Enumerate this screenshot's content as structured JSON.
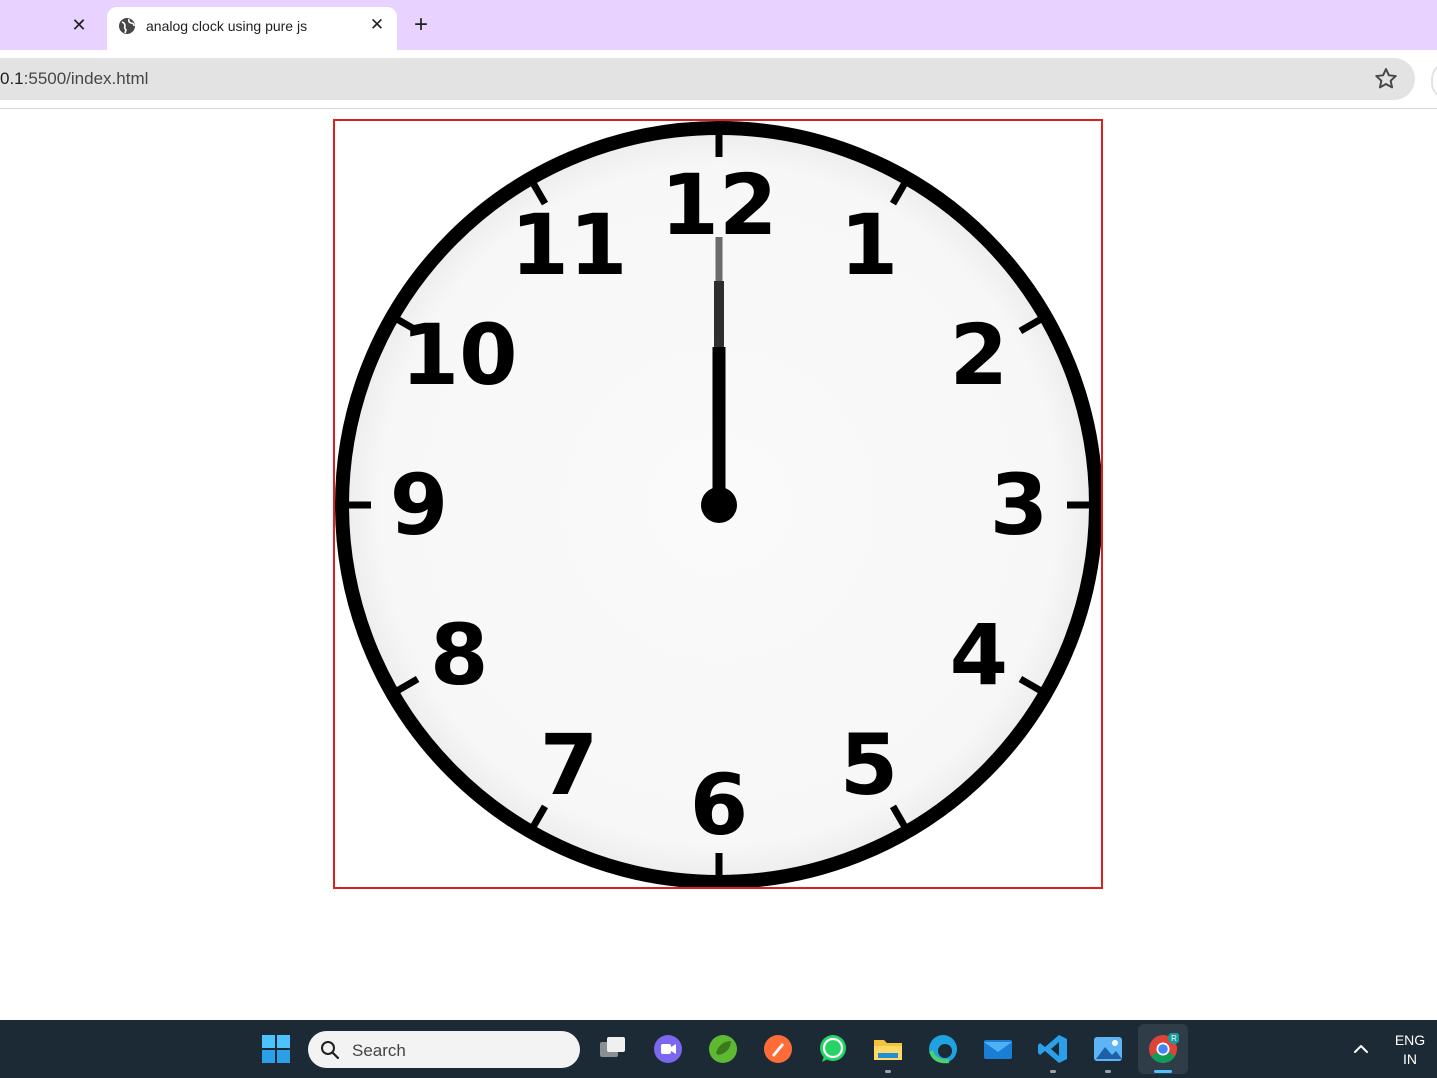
{
  "browser": {
    "tab_title": "analog clock using pure js",
    "prev_tab_close": "✕",
    "tab_close": "✕",
    "new_tab": "+",
    "url_host": "0.1",
    "url_rest": ":5500/index.html"
  },
  "clock": {
    "numerals": [
      "12",
      "1",
      "2",
      "3",
      "4",
      "5",
      "6",
      "7",
      "8",
      "9",
      "10",
      "11"
    ],
    "time": {
      "hour": 12,
      "minute": 0,
      "second": 0
    }
  },
  "taskbar": {
    "search_placeholder": "Search",
    "lang_line1": "ENG",
    "lang_line2": "IN",
    "apps": [
      "start-icon",
      "task-view-icon",
      "meet-icon",
      "spring-icon",
      "postman-icon",
      "whatsapp-icon",
      "file-explorer-icon",
      "edge-icon",
      "mail-icon",
      "vscode-icon",
      "photos-icon",
      "chrome-icon"
    ]
  },
  "colors": {
    "tabstrip": "#e8d2ff",
    "frame_border": "#dd1f1f",
    "taskbar": "#1c2a36"
  }
}
